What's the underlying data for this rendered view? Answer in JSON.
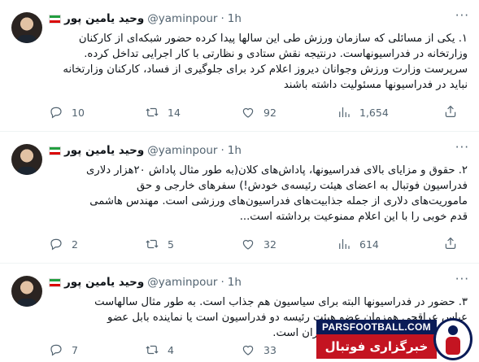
{
  "author": {
    "display_name": "وحید یامین پور",
    "handle": "@yaminpour",
    "dot": "·"
  },
  "more_icon": "more-horizontal-icon",
  "tweets": [
    {
      "time": "1h",
      "lines": [
        "۱. یکی از مسائلی که سازمان ورزش طی این سالها پیدا کرده حضور شبکه‌ای از کارکنان",
        "وزارتخانه در فدراسیونهاست. درنتیجه نقش ستادی و نظارتی با کار اجرایی تداخل کرده.",
        "سرپرست وزارت ورزش وجوانان دیروز اعلام کرد برای جلوگیری از فساد، کارکنان وزارتخانه",
        "نباید در فدراسیونها مسئولیت داشته باشند"
      ],
      "replies": "10",
      "retweets": "14",
      "likes": "92",
      "views": "1,654"
    },
    {
      "time": "1h",
      "lines": [
        "۲. حقوق و مزایای بالای فدراسیونها، پاداش‌های کلان(به طور مثال پاداش ۲۰هزار دلاری",
        "فدراسیون فوتبال به اعضای هیئت رئیسه‌ی خودش!) سفرهای خارجی و حق",
        "ماموریت‌های دلاری از جمله جذابیت‌های فدراسیون‌های ورزشی است. مهندس هاشمی",
        "قدم خوبی را با این اعلام ممنوعیت برداشته است..."
      ],
      "replies": "2",
      "retweets": "5",
      "likes": "32",
      "views": "614"
    },
    {
      "time": "1h",
      "lines": [
        "۳. حضور در فدراسیونها البته برای سیاسیون هم جذاب است. به طور مثال سالهاست",
        "عباس عراقچی همزمان عضو هیئت رئیسه دو فدراسیون است یا نماینده بابل عضو",
        "و رئیس هیئت سوارکاری استان تهران است."
      ],
      "replies": "7",
      "retweets": "4",
      "likes": "33",
      "views": ""
    }
  ],
  "watermark": {
    "site": "PARSFOOTBALL.COM",
    "tagline": "خبرگزاری فوتبال ایران"
  },
  "colors": {
    "text_primary": "#0f1419",
    "text_secondary": "#536471",
    "divider": "#eff3f4",
    "watermark_blue": "#0a1b57",
    "watermark_red": "#c41421"
  }
}
